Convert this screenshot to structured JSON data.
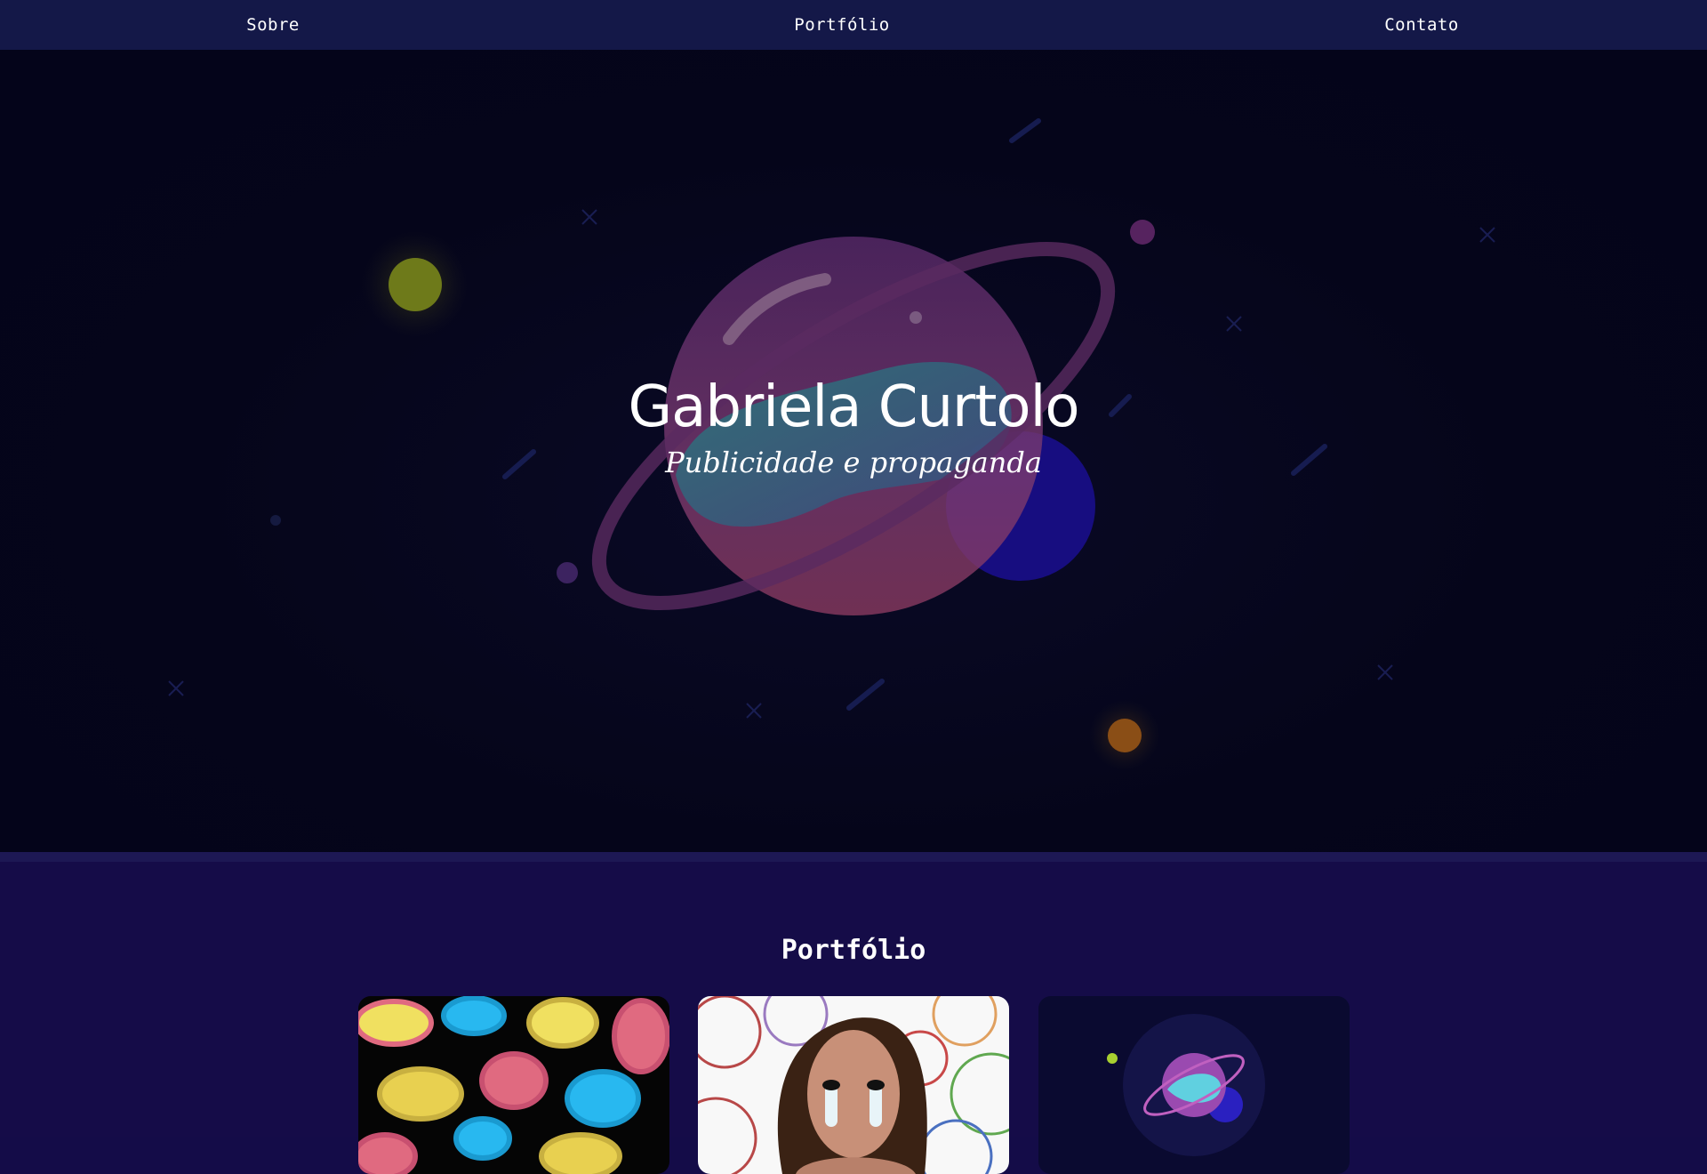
{
  "nav": {
    "items": [
      {
        "label": "Sobre"
      },
      {
        "label": "Portfólio"
      },
      {
        "label": "Contato"
      }
    ]
  },
  "hero": {
    "title": "Gabriela Curtolo",
    "subtitle": "Publicidade e propaganda"
  },
  "portfolio": {
    "heading": "Portfólio",
    "cards": [
      {
        "image": "abstract-swirls-art"
      },
      {
        "image": "smiley-portrait-art"
      },
      {
        "image": "planet-illustration"
      }
    ]
  },
  "colors": {
    "nav_bg": "#141848",
    "hero_bg": "#05051a",
    "section_bg": "#150c48",
    "text": "#ffffff"
  }
}
